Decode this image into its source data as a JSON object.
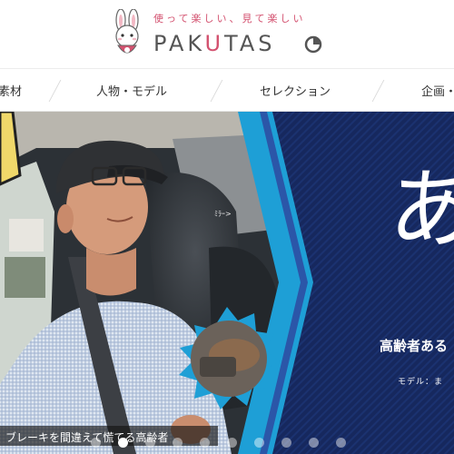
{
  "header": {
    "tagline": "使って楽しい、見て楽しい",
    "brand_prefix": "PAK",
    "brand_u": "U",
    "brand_suffix": "TAS",
    "logo_colors": {
      "accent": "#d3516f",
      "text": "#555555"
    }
  },
  "nav": {
    "items": [
      {
        "label": "素材"
      },
      {
        "label": "人物・モデル"
      },
      {
        "label": "セレクション"
      },
      {
        "label": "企画・"
      }
    ]
  },
  "hero": {
    "big_char": "あ",
    "subtitle": "高齢者ある",
    "model_text": "モデル：ま",
    "mirror_label": "ﾐﾗｰ>",
    "caption": "ブレーキを間違えて慌てる高齢者",
    "colors": {
      "panel_navy": "#16285e",
      "panel_stripe": "#1e9fd6"
    },
    "slides": {
      "count": 10,
      "active_index": 1
    }
  }
}
